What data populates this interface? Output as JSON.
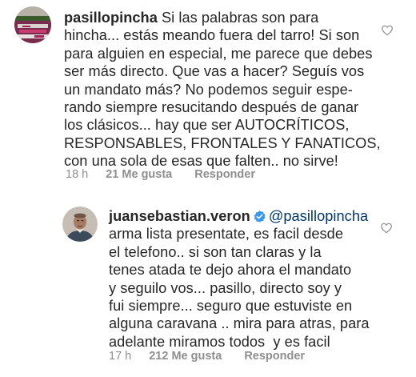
{
  "comment1": {
    "username": "pasillopincha",
    "text_lines": [
      "Si las palabras son para",
      "hincha... estás meando fuera del tarro! Si son",
      "para alguien en especial, me parece que debes",
      "ser más directo. Que vas a hacer? Seguís vos",
      "un mandato más? No podemos seguir espe-",
      "rando siempre resucitando después de ganar",
      "los clásicos... hay que ser AUTOCRÍTICOS,",
      "RESPONSABLES, FRONTALES Y FANATICOS,",
      "con una sola de esas que falten.. no sirve!"
    ],
    "time": "18 h",
    "likes": "21 Me gusta",
    "reply": "Responder",
    "avatar_icon": "stadium-photo-avatar"
  },
  "comment2": {
    "username": "juansebastian.veron",
    "verified_icon": "verified-badge-icon",
    "mention": "@pasillopincha",
    "text_lines": [
      "arma lista presentate, es facil desde",
      "el telefono.. si son tan claras y la",
      "tenes atada te dejo ahora el mandato",
      "y seguilo vos... pasillo, directo soy y",
      "fui siempre... seguro que estuviste en",
      "alguna caravana .. mira para atras, para",
      "adelante miramos todos  y es facil"
    ],
    "time": "17 h",
    "likes": "212 Me gusta",
    "reply": "Responder",
    "avatar_icon": "man-portrait-avatar"
  },
  "colors": {
    "text": "#262626",
    "secondary": "#8e8e8e",
    "mention": "#00376b",
    "verified": "#3897f0"
  }
}
